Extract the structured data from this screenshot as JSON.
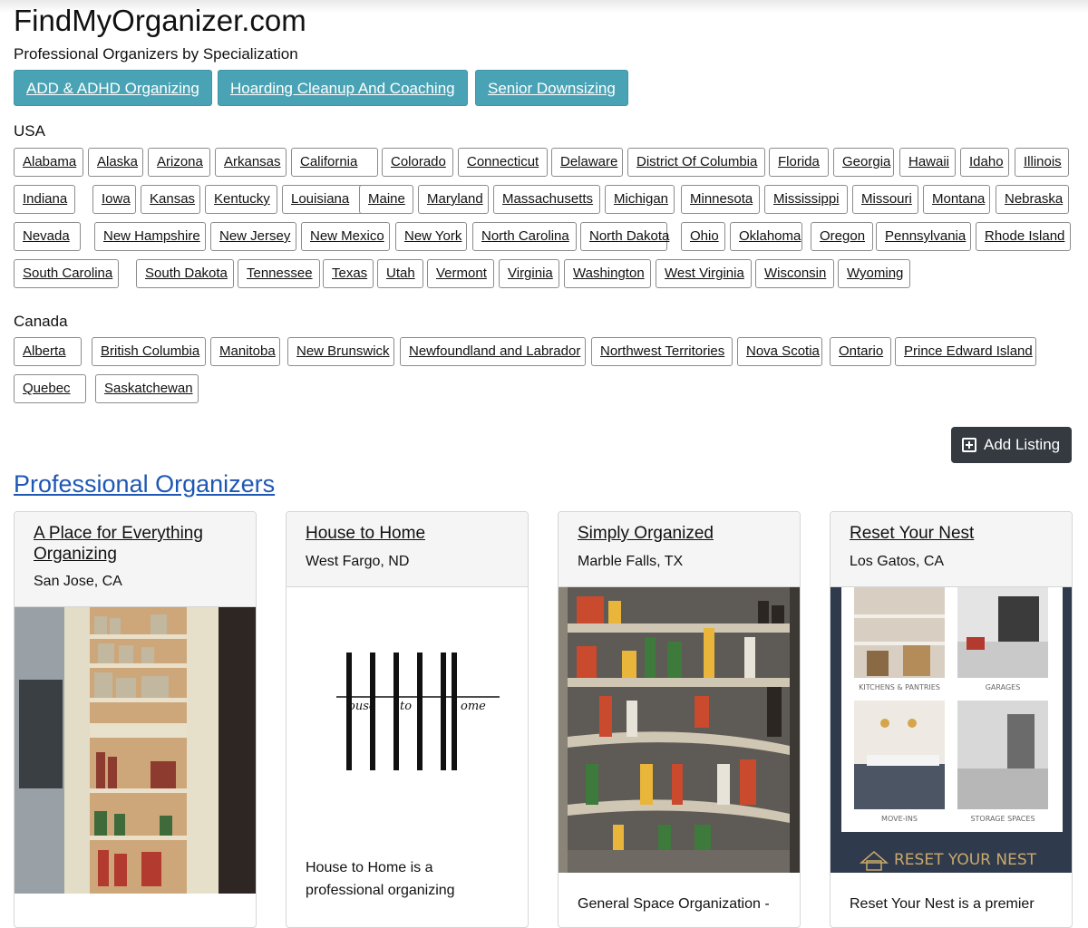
{
  "site": {
    "title": "FindMyOrganizer.com",
    "subtitle": "Professional Organizers by Specialization"
  },
  "specializations": [
    "ADD & ADHD Organizing",
    "Hoarding Cleanup And Coaching",
    "Senior Downsizing"
  ],
  "usa": {
    "label": "USA",
    "states": [
      "Alabama",
      "Alaska",
      "Arizona",
      "Arkansas",
      "California",
      "Colorado",
      "Connecticut",
      "Delaware",
      "District Of Columbia",
      "Florida",
      "Georgia",
      "Hawaii",
      "Idaho",
      "Illinois",
      "Indiana",
      "Iowa",
      "Kansas",
      "Kentucky",
      "Louisiana",
      "Maine",
      "Maryland",
      "Massachusetts",
      "Michigan",
      "Minnesota",
      "Mississippi",
      "Missouri",
      "Montana",
      "Nebraska",
      "Nevada",
      "New Hampshire",
      "New Jersey",
      "New Mexico",
      "New York",
      "North Carolina",
      "North Dakota",
      "Ohio",
      "Oklahoma",
      "Oregon",
      "Pennsylvania",
      "Rhode Island",
      "South Carolina",
      "South Dakota",
      "Tennessee",
      "Texas",
      "Utah",
      "Vermont",
      "Virginia",
      "Washington",
      "West Virginia",
      "Wisconsin",
      "Wyoming"
    ]
  },
  "canada": {
    "label": "Canada",
    "provinces": [
      "Alberta",
      "British Columbia",
      "Manitoba",
      "New Brunswick",
      "Newfoundland and Labrador",
      "Northwest Territories",
      "Nova Scotia",
      "Ontario",
      "Prince Edward Island",
      "Quebec",
      "Saskatchewan"
    ]
  },
  "add_listing": {
    "label": "Add Listing",
    "icon": "plus-square-icon"
  },
  "section": {
    "title": "Professional Organizers"
  },
  "organizers": [
    {
      "name": "A Place for Everything Organizing",
      "location": "San Jose, CA",
      "description": ""
    },
    {
      "name": "House to Home",
      "location": "West Fargo, ND",
      "description": "House to Home is a professional organizing",
      "logo_words": [
        "ouse",
        "to",
        "ome"
      ]
    },
    {
      "name": "Simply Organized",
      "location": "Marble Falls, TX",
      "description": "General Space Organization -"
    },
    {
      "name": "Reset Your Nest",
      "location": "Los Gatos, CA",
      "description": "Reset Your Nest is a premier",
      "collage_labels": [
        "KITCHENS & PANTRIES",
        "GARAGES",
        "MOVE-INS",
        "STORAGE SPACES"
      ],
      "brand": "RESET YOUR NEST"
    }
  ],
  "colors": {
    "spec_button": "#4aa3b5",
    "link_blue": "#1f57b5",
    "dark_button": "#343a40"
  }
}
